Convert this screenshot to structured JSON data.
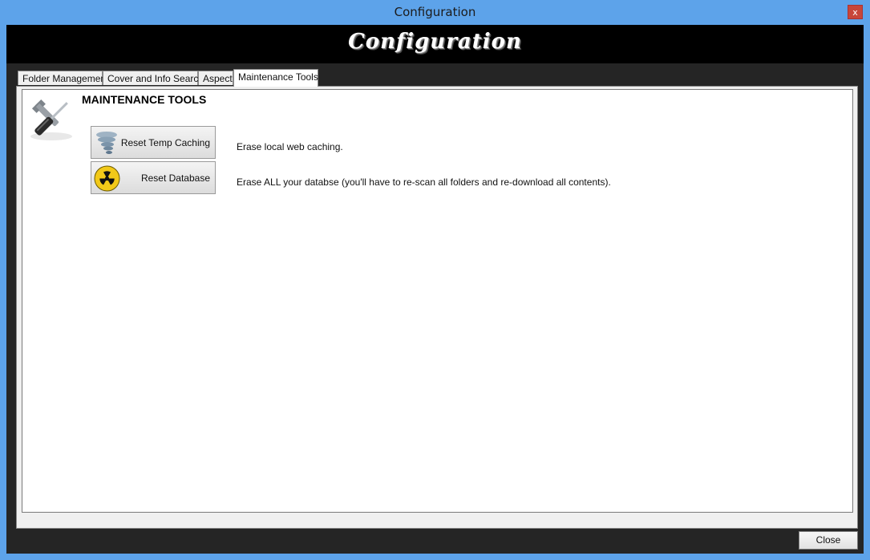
{
  "window": {
    "title": "Configuration",
    "close_glyph": "x"
  },
  "banner": {
    "title": "Configuration"
  },
  "tabs": [
    {
      "label": "Folder Management"
    },
    {
      "label": "Cover and Info Search"
    },
    {
      "label": "Aspect"
    },
    {
      "label": "Maintenance Tools",
      "active": true
    }
  ],
  "maintenance": {
    "section_title": "MAINTENANCE TOOLS",
    "section_icon": "tools-icon",
    "actions": [
      {
        "button_label": "Reset Temp Caching",
        "icon": "tornado-icon",
        "description": "Erase local web caching."
      },
      {
        "button_label": "Reset Database",
        "icon": "radiation-icon",
        "description": "Erase ALL your databse (you'll have to re-scan all folders and re-download all contents)."
      }
    ]
  },
  "footer": {
    "close_label": "Close"
  },
  "colors": {
    "title_bar": "#5da3ea",
    "banner": "#000000",
    "client": "#252525",
    "close_x": "#c7463a"
  }
}
